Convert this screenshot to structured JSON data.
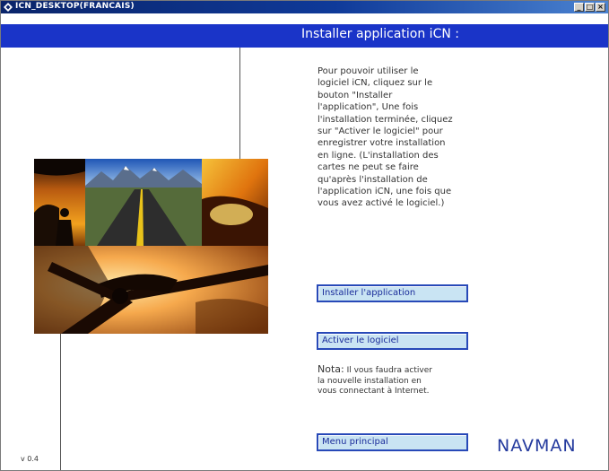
{
  "window": {
    "title": "ICN_DESKTOP(FRANCAIS)",
    "buttons": {
      "minimize": "_",
      "maximize": "□",
      "close": "×"
    }
  },
  "header": {
    "title": "Installer application iCN :"
  },
  "description": "Pour pouvoir utiliser le\nlogiciel iCN, cliquez sur le\nbouton \"Installer\nl'application\", Une fois\nl'installation terminée, cliquez\nsur \"Activer le logiciel\" pour\nenregistrer votre installation\nen ligne. (L'installation des\ncartes ne peut se faire\nqu'après l'installation de\nl'application iCN, une fois que\nvous avez activé le logiciel.)",
  "buttons": {
    "install": "Installer l'application",
    "activate": "Activer le logiciel",
    "main_menu": "Menu principal"
  },
  "note": {
    "label": "Nota:",
    "text": "Il vous faudra activer\nla nouvelle installation en\nvous connectant à Internet."
  },
  "brand": "NAVMAN",
  "version": "v 0.4",
  "colors": {
    "header_bg": "#1a34c8",
    "titlebar": "#0a246a",
    "button_bg": "#c9e4f3",
    "button_border": "#2749b8",
    "brand": "#243a9e"
  },
  "icons": [
    "app-diamond-icon",
    "minimize-icon",
    "maximize-icon",
    "close-icon"
  ]
}
